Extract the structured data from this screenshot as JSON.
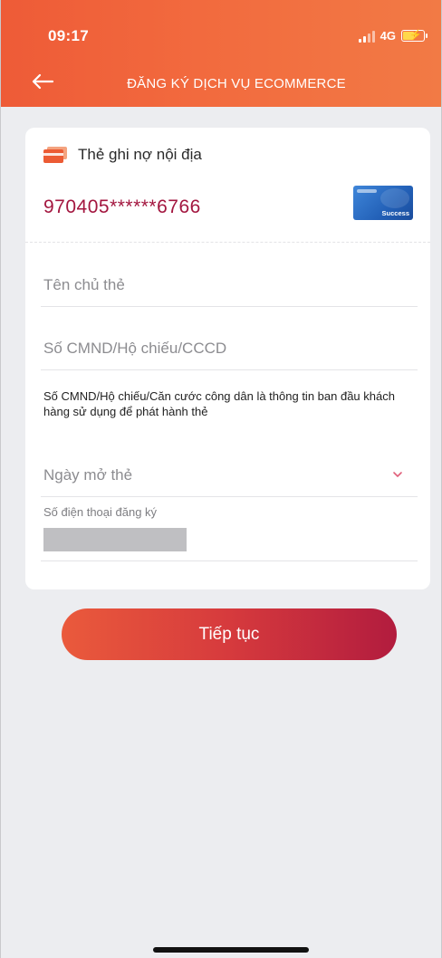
{
  "status_bar": {
    "time": "09:17",
    "network": "4G"
  },
  "nav": {
    "back_icon": "arrow-left-icon",
    "title": "ĐĂNG KÝ DỊCH VỤ ECOMMERCE"
  },
  "card": {
    "type_icon": "card-stack-icon",
    "type_label": "Thẻ ghi nợ nội địa",
    "number": "970405******6766",
    "thumb_text": "Success"
  },
  "form": {
    "cardholder_name_placeholder": "Tên chủ thẻ",
    "id_number_placeholder": "Số CMND/Hộ chiếu/CCCD",
    "id_helper": "Số CMND/Hộ chiếu/Căn cước công dân là thông tin ban đầu khách hàng sử dụng để phát hành thẻ",
    "open_date_placeholder": "Ngày mở thẻ",
    "open_date_icon": "chevron-down-icon",
    "phone_label": "Số điện thoại đăng ký"
  },
  "actions": {
    "continue_label": "Tiếp tục"
  },
  "colors": {
    "header_start": "#ee5b37",
    "header_end": "#f27a45",
    "card_number": "#a3163f",
    "button_start": "#ea5a3c",
    "button_end": "#b21c3e"
  }
}
